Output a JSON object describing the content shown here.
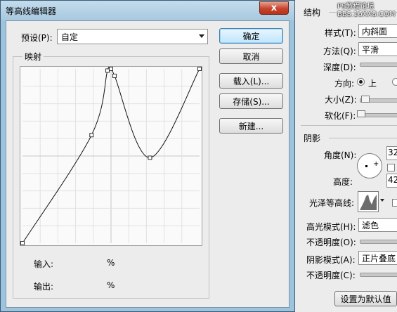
{
  "background_dialog": {
    "watermark": "PS教程论坛\nBBS.16XX8.COM",
    "structure": {
      "title": "结构",
      "style_label": "样式(T):",
      "style_value": "内斜面",
      "method_label": "方法(Q):",
      "method_value": "平滑",
      "depth_label": "深度(D):",
      "direction_label": "方向:",
      "direction_up": "上",
      "size_label": "大小(Z):",
      "soften_label": "软化(F):"
    },
    "shading": {
      "title": "阴影",
      "angle_label": "角度(N):",
      "angle_value": "32",
      "altitude_label": "高度:",
      "altitude_value": "42",
      "gloss_contour_label": "光泽等高线:",
      "highlight_mode_label": "高光模式(H):",
      "highlight_mode_value": "滤色",
      "opacity1_label": "不透明度(O):",
      "shadow_mode_label": "阴影模式(A):",
      "shadow_mode_value": "正片叠底",
      "opacity2_label": "不透明度(C):"
    },
    "set_default_button": "设置为默认值"
  },
  "window": {
    "title": "等高线编辑器",
    "close_glyph": "x"
  },
  "preset": {
    "label": "预设(P):",
    "value": "自定"
  },
  "mapping": {
    "title": "映射",
    "input_label": "输入:",
    "input_unit": "%",
    "output_label": "输出:",
    "output_unit": "%"
  },
  "buttons": {
    "ok": "确定",
    "cancel": "取消",
    "load": "载入(L)...",
    "save": "存储(S)...",
    "new": "新建..."
  },
  "curve": {
    "points": [
      [
        0,
        0
      ],
      [
        39,
        62
      ],
      [
        48,
        99
      ],
      [
        50,
        100
      ],
      [
        52,
        96
      ],
      [
        72,
        49
      ],
      [
        100,
        100
      ]
    ]
  }
}
